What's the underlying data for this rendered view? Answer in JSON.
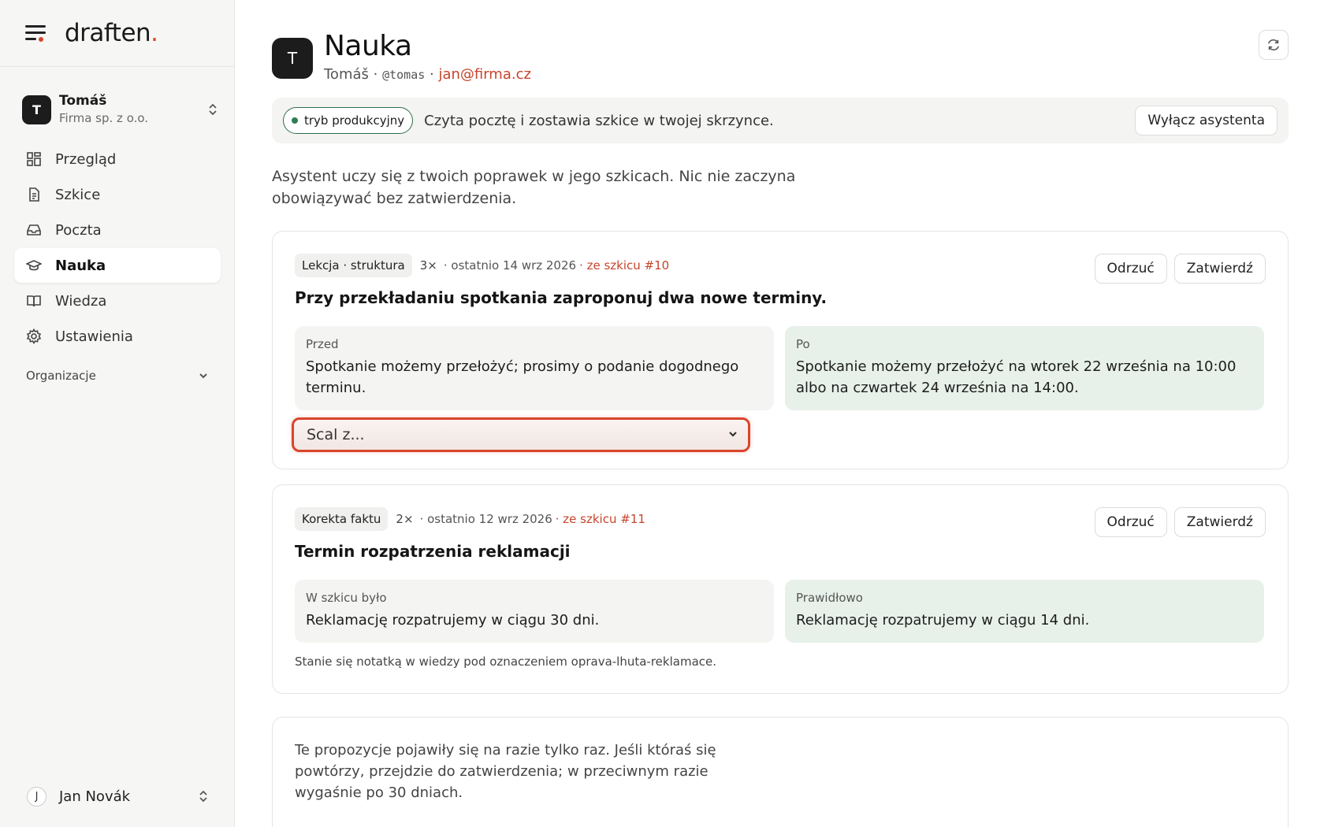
{
  "brand": {
    "name": "draften",
    "dot": "."
  },
  "workspace": {
    "initial": "T",
    "name": "Tomáš",
    "org": "Firma sp. z o.o."
  },
  "nav": {
    "items": [
      {
        "label": "Przegląd",
        "icon": "grid-icon"
      },
      {
        "label": "Szkice",
        "icon": "document-icon"
      },
      {
        "label": "Poczta",
        "icon": "inbox-icon"
      },
      {
        "label": "Nauka",
        "icon": "graduation-cap-icon",
        "active": true
      },
      {
        "label": "Wiedza",
        "icon": "book-icon"
      },
      {
        "label": "Ustawienia",
        "icon": "gear-icon"
      }
    ],
    "section_label": "Organizacje"
  },
  "user": {
    "initial": "J",
    "name": "Jan Novák"
  },
  "header": {
    "initial": "T",
    "title": "Nauka",
    "name": "Tomáš",
    "sep1": " · ",
    "handle": "@tomas",
    "sep2": " · ",
    "email": "jan@firma.cz"
  },
  "mode": {
    "pill": "tryb produkcyjny",
    "text": "Czyta pocztę i zostawia szkice w twojej skrzynce.",
    "button": "Wyłącz asystenta"
  },
  "intro": "Asystent uczy się z twoich poprawek w jego szkicach. Nic nie zaczyna obowiązywać bez zatwierdzenia.",
  "cards": [
    {
      "tag": "Lekcja · struktura",
      "count": "3×",
      "meta": "· ostatnio 14 wrz 2026",
      "source": "· ze szkicu #10",
      "reject": "Odrzuć",
      "approve": "Zatwierdź",
      "title": "Przy przekładaniu spotkania zaproponuj dwa nowe terminy.",
      "before_label": "Przed",
      "before_text": "Spotkanie możemy przełożyć; prosimy o podanie dogodnego terminu.",
      "after_label": "Po",
      "after_text": "Spotkanie możemy przełożyć na wtorek 22 września na 10:00 albo na czwartek 24 września na 14:00.",
      "merge_select": "Scal z..."
    },
    {
      "tag": "Korekta faktu",
      "count": "2×",
      "meta": "· ostatnio 12 wrz 2026",
      "source": "· ze szkicu #11",
      "reject": "Odrzuć",
      "approve": "Zatwierdź",
      "title": "Termin rozpatrzenia reklamacji",
      "before_label": "W szkicu było",
      "before_text": "Reklamację rozpatrujemy w ciągu 30 dni.",
      "after_label": "Prawidłowo",
      "after_text": "Reklamację rozpatrujemy w ciągu 14 dni.",
      "note": "Stanie się notatką w wiedzy pod oznaczeniem oprava-lhuta-reklamace."
    }
  ],
  "pending_note": "Te propozycje pojawiły się na razie tylko raz. Jeśli któraś się powtórzy, przejdzie do zatwierdzenia; w przeciwnym razie wygaśnie po 30 dniach.",
  "colors": {
    "accent": "#d9452b",
    "success": "#2f7d53",
    "after_bg": "#e7f1ea"
  }
}
